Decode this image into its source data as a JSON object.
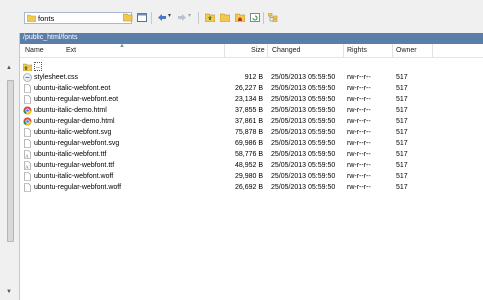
{
  "toolbar": {
    "location": "fonts"
  },
  "path": "/public_html/fonts",
  "columns": {
    "name": "Name",
    "ext": "Ext",
    "size": "Size",
    "changed": "Changed",
    "rights": "Rights",
    "owner": "Owner"
  },
  "parent": "..",
  "files": [
    {
      "name": "stylesheet.css",
      "size": "912 B",
      "changed": "25/05/2013 05:59:50",
      "rights": "rw-r--r--",
      "owner": "517",
      "icon": "css-file-icon"
    },
    {
      "name": "ubuntu-italic-webfont.eot",
      "size": "26,227 B",
      "changed": "25/05/2013 05:59:50",
      "rights": "rw-r--r--",
      "owner": "517",
      "icon": "blank-file-icon"
    },
    {
      "name": "ubuntu-regular-webfont.eot",
      "size": "23,134 B",
      "changed": "25/05/2013 05:59:50",
      "rights": "rw-r--r--",
      "owner": "517",
      "icon": "blank-file-icon"
    },
    {
      "name": "ubuntu-italic-demo.html",
      "size": "37,855 B",
      "changed": "25/05/2013 05:59:50",
      "rights": "rw-r--r--",
      "owner": "517",
      "icon": "chrome-icon"
    },
    {
      "name": "ubuntu-regular-demo.html",
      "size": "37,861 B",
      "changed": "25/05/2013 05:59:50",
      "rights": "rw-r--r--",
      "owner": "517",
      "icon": "chrome-icon"
    },
    {
      "name": "ubuntu-italic-webfont.svg",
      "size": "75,878 B",
      "changed": "25/05/2013 05:59:50",
      "rights": "rw-r--r--",
      "owner": "517",
      "icon": "blank-file-icon"
    },
    {
      "name": "ubuntu-regular-webfont.svg",
      "size": "69,986 B",
      "changed": "25/05/2013 05:59:50",
      "rights": "rw-r--r--",
      "owner": "517",
      "icon": "blank-file-icon"
    },
    {
      "name": "ubuntu-italic-webfont.ttf",
      "size": "58,776 B",
      "changed": "25/05/2013 05:59:50",
      "rights": "rw-r--r--",
      "owner": "517",
      "icon": "font-file-icon"
    },
    {
      "name": "ubuntu-regular-webfont.ttf",
      "size": "48,952 B",
      "changed": "25/05/2013 05:59:50",
      "rights": "rw-r--r--",
      "owner": "517",
      "icon": "font-file-icon"
    },
    {
      "name": "ubuntu-italic-webfont.woff",
      "size": "29,980 B",
      "changed": "25/05/2013 05:59:50",
      "rights": "rw-r--r--",
      "owner": "517",
      "icon": "blank-file-icon"
    },
    {
      "name": "ubuntu-regular-webfont.woff",
      "size": "26,692 B",
      "changed": "25/05/2013 05:59:50",
      "rights": "rw-r--r--",
      "owner": "517",
      "icon": "blank-file-icon"
    }
  ],
  "colors": {
    "path_bar": "#5b7ea9",
    "folder": "#f2c94c"
  }
}
